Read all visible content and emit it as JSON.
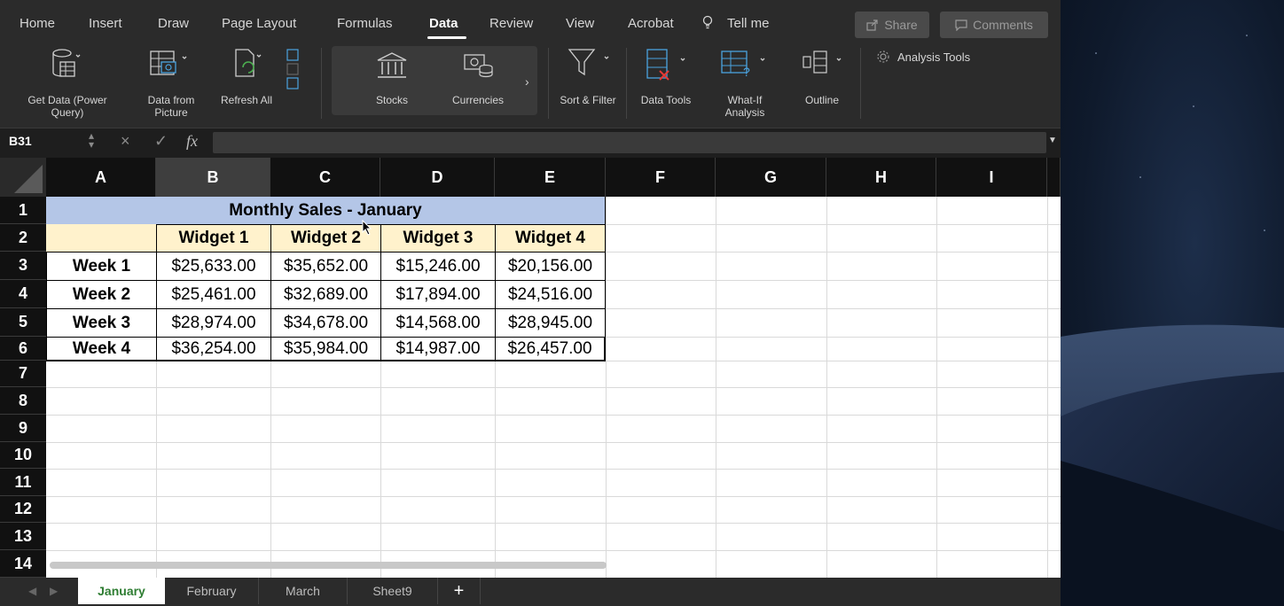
{
  "ribbon_tabs": [
    {
      "label": "Home"
    },
    {
      "label": "Insert"
    },
    {
      "label": "Draw"
    },
    {
      "label": "Page Layout"
    },
    {
      "label": "Formulas"
    },
    {
      "label": "Data"
    },
    {
      "label": "Review"
    },
    {
      "label": "View"
    },
    {
      "label": "Acrobat"
    },
    {
      "label": "Tell me"
    }
  ],
  "active_tab": "Data",
  "share_label": "Share",
  "comments_label": "Comments",
  "ribbon": {
    "get_data": "Get Data (Power Query)",
    "data_from_picture": "Data from Picture",
    "refresh_all": "Refresh All",
    "stocks": "Stocks",
    "currencies": "Currencies",
    "sort_filter": "Sort & Filter",
    "data_tools": "Data Tools",
    "what_if": "What-If Analysis",
    "outline": "Outline",
    "analysis_tools": "Analysis Tools"
  },
  "formula_bar": {
    "name_box": "B31",
    "fx": "fx",
    "formula": ""
  },
  "columns": [
    "A",
    "B",
    "C",
    "D",
    "E",
    "F",
    "G",
    "H",
    "I"
  ],
  "selected_column": "B",
  "rows": [
    "1",
    "2",
    "3",
    "4",
    "5",
    "6",
    "7",
    "8",
    "9",
    "10",
    "11",
    "12",
    "13",
    "14"
  ],
  "table": {
    "title": "Monthly Sales - January",
    "headers": [
      "Widget 1",
      "Widget 2",
      "Widget 3",
      "Widget 4"
    ],
    "rows": [
      {
        "week": "Week 1",
        "values": [
          "$25,633.00",
          "$35,652.00",
          "$15,246.00",
          "$20,156.00"
        ]
      },
      {
        "week": "Week 2",
        "values": [
          "$25,461.00",
          "$32,689.00",
          "$17,894.00",
          "$24,516.00"
        ]
      },
      {
        "week": "Week 3",
        "values": [
          "$28,974.00",
          "$34,678.00",
          "$14,568.00",
          "$28,945.00"
        ]
      },
      {
        "week": "Week 4",
        "values": [
          "$36,254.00",
          "$35,984.00",
          "$14,987.00",
          "$26,457.00"
        ]
      }
    ]
  },
  "sheet_tabs": [
    {
      "label": "January",
      "active": true
    },
    {
      "label": "February"
    },
    {
      "label": "March"
    },
    {
      "label": "Sheet9"
    }
  ],
  "add_sheet": "+",
  "colors": {
    "title_fill": "#b4c6e7",
    "header_fill": "#fff2cc",
    "active_sheet_text": "#2e7d32"
  }
}
